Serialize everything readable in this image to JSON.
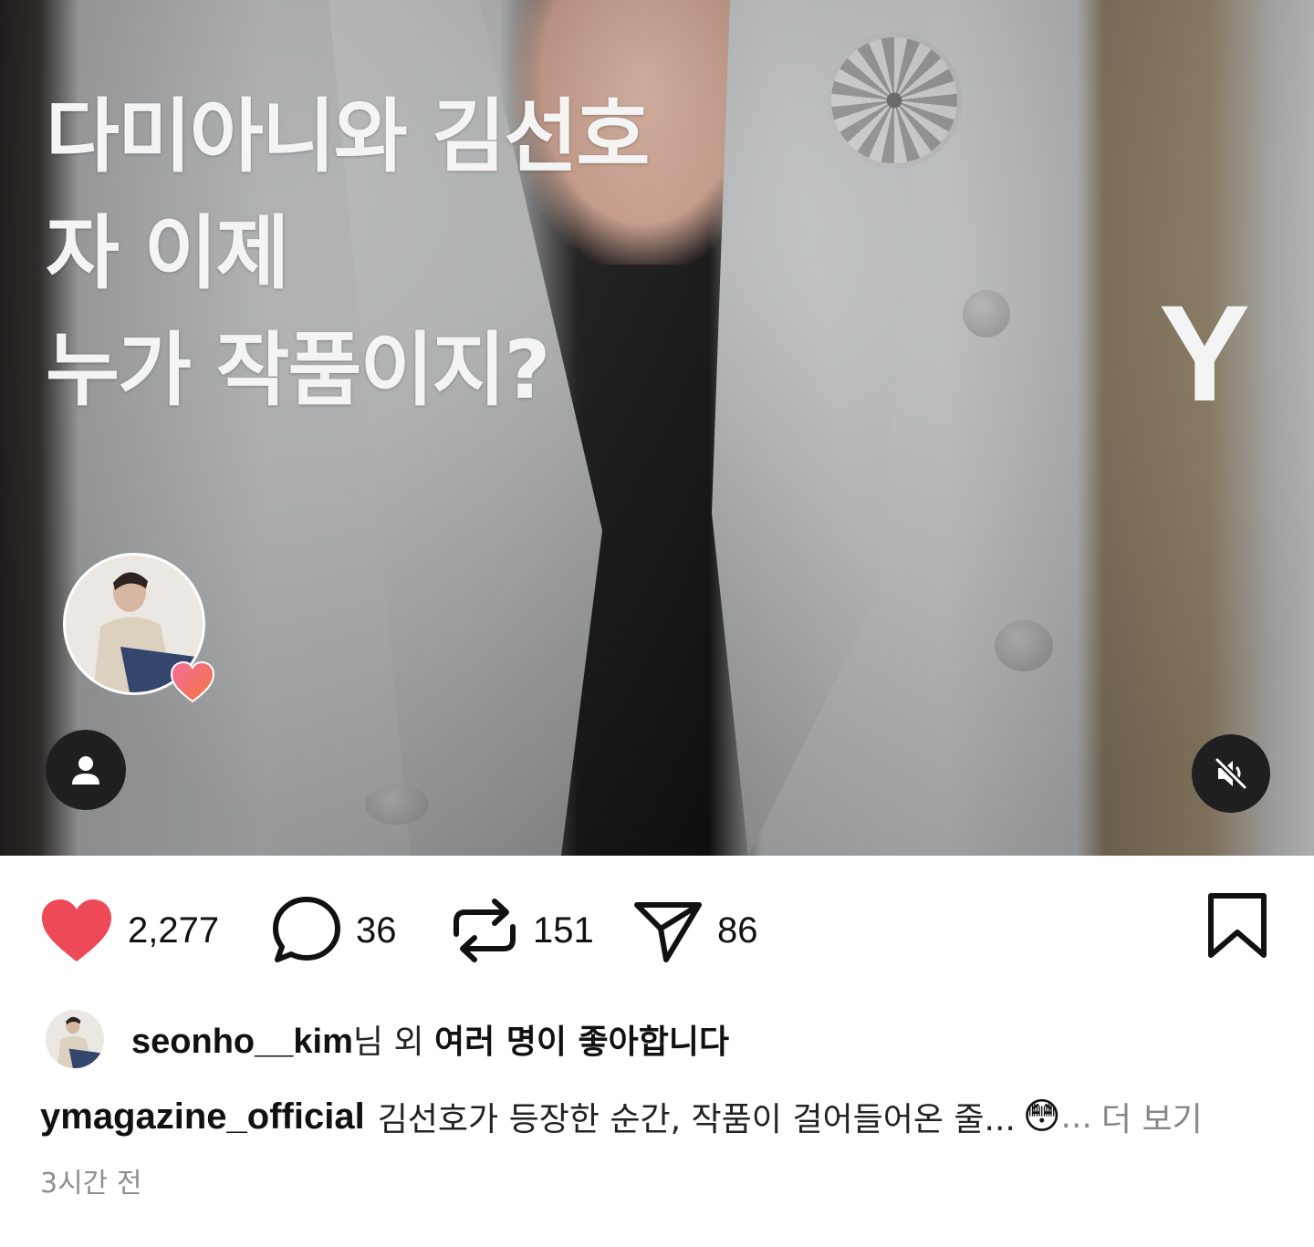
{
  "media": {
    "headline_lines": [
      "다미아니와 김선호",
      "자 이제",
      "누가 작품이지?"
    ],
    "watermark": "Y"
  },
  "icons": {
    "profile_avatar": "avatar-photo",
    "avatar_badge": "heart-gradient-icon",
    "user_button": "person-icon",
    "mute_button": "speaker-muted-icon",
    "like": "heart-filled-icon",
    "comment": "speech-bubble-icon",
    "repost": "repost-arrows-icon",
    "share": "paper-plane-icon",
    "bookmark": "bookmark-icon"
  },
  "actions": {
    "likes": "2,277",
    "comments": "36",
    "reposts": "151",
    "shares": "86"
  },
  "likes_line": {
    "username": "seonho__kim",
    "suffix": "님 외 ",
    "suffix_bold": "여러 명이 좋아합니다"
  },
  "caption": {
    "username": "ymagazine_official",
    "text": "김선호가 등장한 순간, 작품이 걸어들어온 줄...",
    "emoji": "😳",
    "ellipsis": "...",
    "more": "더 보기"
  },
  "timestamp": "3시간 전",
  "colors": {
    "like_red": "#ed4956",
    "text": "#111111",
    "secondary_text": "#8e8e8e",
    "overlay_button": "#1f1f1f"
  }
}
